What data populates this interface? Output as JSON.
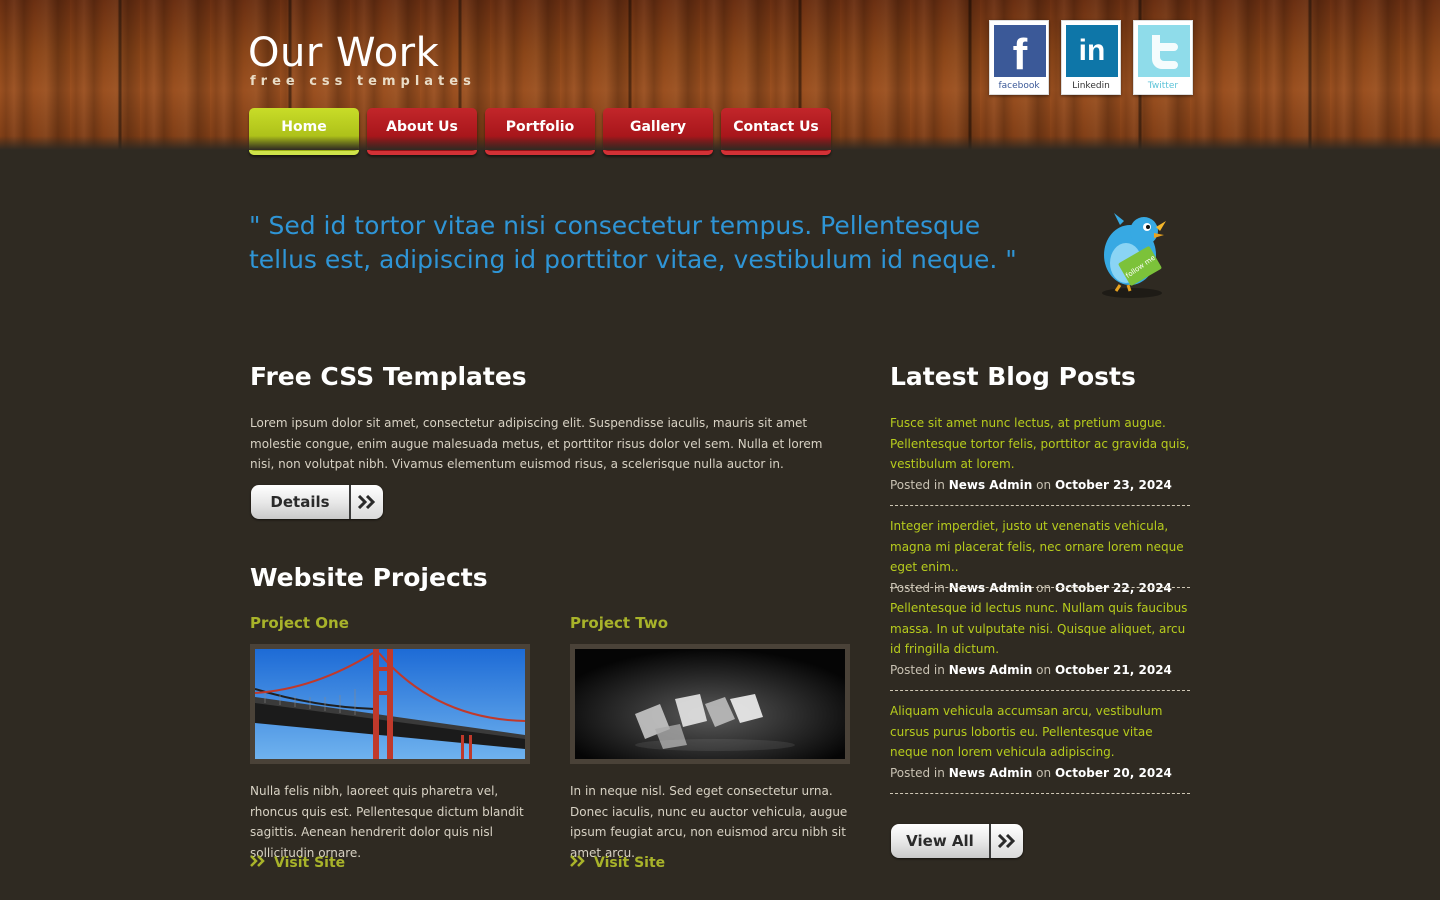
{
  "header": {
    "title": "Our Work",
    "subtitle": "free css templates",
    "social": [
      {
        "label": "facebook",
        "icon": "facebook-icon"
      },
      {
        "label": "Linkedin",
        "icon": "linkedin-icon"
      },
      {
        "label": "Twitter",
        "icon": "twitter-icon"
      }
    ]
  },
  "nav": {
    "items": [
      "Home",
      "About Us",
      "Portfolio",
      "Gallery",
      "Contact Us"
    ],
    "active": "Home"
  },
  "quote": {
    "text": "\" Sed id tortor vitae nisi consectetur tempus. Pellentesque tellus est, adipiscing id porttitor vitae, vestibulum id neque. \"",
    "bird_badge": "follow me"
  },
  "intro": {
    "heading": "Free CSS Templates",
    "body": "Lorem ipsum dolor sit amet, consectetur adipiscing elit. Suspendisse iaculis, mauris sit amet molestie congue, enim augue malesuada metus, et porttitor risus dolor vel sem. Nulla et lorem nisi, non volutpat nibh. Vivamus elementum euismod risus, a scelerisque nulla auctor in.",
    "button": "Details"
  },
  "projects": {
    "heading": "Website Projects",
    "items": [
      {
        "title": "Project One",
        "body": "Nulla felis nibh, laoreet quis pharetra vel, rhoncus quis est. Pellentesque dictum blandit sagittis. Aenean hendrerit dolor quis nisl sollicitudin ornare.",
        "link": "Visit Site"
      },
      {
        "title": "Project Two",
        "body": "In in neque nisl. Sed eget consectetur urna. Donec iaculis, nunc eu auctor vehicula, augue ipsum feugiat arcu, non euismod arcu nibh sit amet arcu.",
        "link": "Visit Site"
      }
    ]
  },
  "blog": {
    "heading": "Latest Blog Posts",
    "posted_in": "Posted in",
    "on": "on",
    "posts": [
      {
        "excerpt": "Fusce sit amet nunc lectus, at pretium augue. Pellentesque tortor felis, porttitor ac gravida quis, vestibulum at lorem.",
        "author": "News Admin",
        "date": "October 23, 2024"
      },
      {
        "excerpt": "Integer imperdiet, justo ut venenatis vehicula, magna mi placerat felis, nec ornare lorem neque eget enim..",
        "author": "News Admin",
        "date": "October 22, 2024"
      },
      {
        "excerpt": "Pellentesque id lectus nunc. Nullam quis faucibus massa. In ut vulputate nisi. Quisque aliquet, arcu id fringilla dictum.",
        "author": "News Admin",
        "date": "October 21, 2024"
      },
      {
        "excerpt": "Aliquam vehicula accumsan arcu, vestibulum cursus purus lobortis eu. Pellentesque vitae neque non lorem vehicula adipiscing.",
        "author": "News Admin",
        "date": "October 20, 2024"
      }
    ],
    "button": "View All"
  },
  "colors": {
    "background": "#2f2a22",
    "nav_red": "#a8161b",
    "nav_active": "#aec11a",
    "quote_blue": "#2f95d6",
    "accent_green": "#b7cc1d"
  }
}
